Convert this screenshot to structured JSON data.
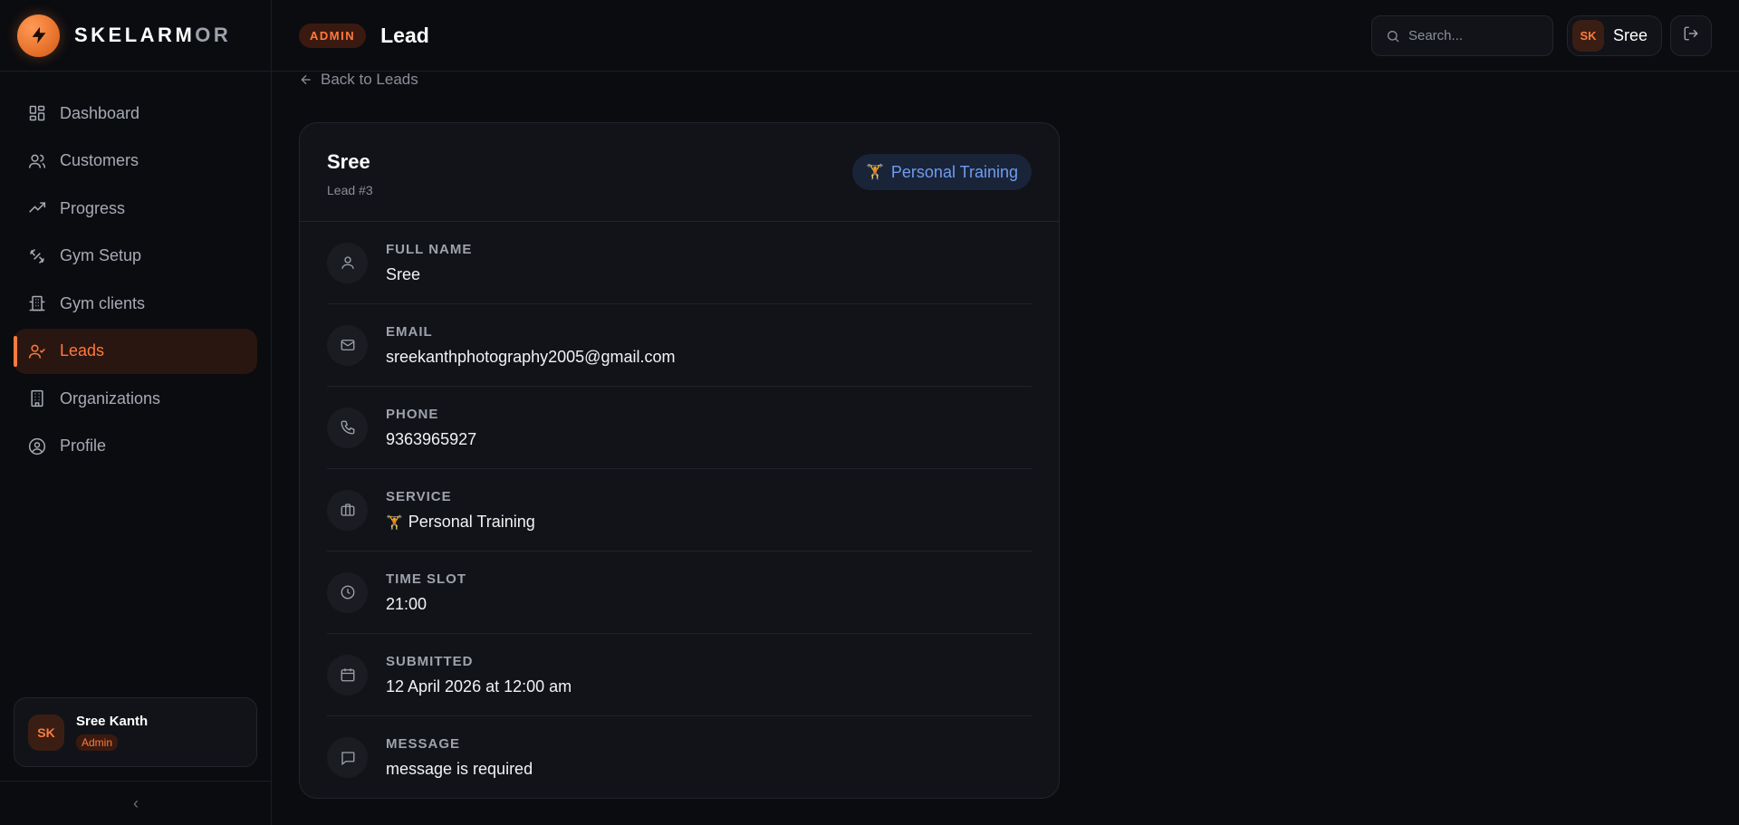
{
  "brand": {
    "name_main": "SKELARM",
    "name_dim": "OR"
  },
  "sidebar": {
    "items": [
      {
        "label": "Dashboard",
        "icon": "grid-icon"
      },
      {
        "label": "Customers",
        "icon": "users-icon"
      },
      {
        "label": "Progress",
        "icon": "trending-up-icon"
      },
      {
        "label": "Gym Setup",
        "icon": "dumbbell-icon"
      },
      {
        "label": "Gym clients",
        "icon": "building-icon"
      },
      {
        "label": "Leads",
        "icon": "user-check-icon",
        "active": true
      },
      {
        "label": "Organizations",
        "icon": "office-icon"
      },
      {
        "label": "Profile",
        "icon": "user-circle-icon"
      }
    ],
    "user": {
      "initials": "SK",
      "name": "Sree Kanth",
      "role": "Admin"
    },
    "collapse_glyph": "‹"
  },
  "header": {
    "badge": "ADMIN",
    "title": "Lead",
    "search_placeholder": "Search...",
    "user_initials": "SK",
    "user_name": "Sree"
  },
  "back_link": "Back to Leads",
  "lead": {
    "name": "Sree",
    "id_label": "Lead #3",
    "service_badge": "Personal Training",
    "service_emoji": "🏋",
    "fields": [
      {
        "label": "FULL NAME",
        "value": "Sree",
        "icon": "user-icon"
      },
      {
        "label": "EMAIL",
        "value": "sreekanthphotography2005@gmail.com",
        "icon": "mail-icon"
      },
      {
        "label": "PHONE",
        "value": "9363965927",
        "icon": "phone-icon"
      },
      {
        "label": "SERVICE",
        "value": "Personal Training",
        "icon": "briefcase-icon"
      },
      {
        "label": "TIME SLOT",
        "value": "21:00",
        "icon": "clock-icon"
      },
      {
        "label": "SUBMITTED",
        "value": "12 April 2026 at 12:00 am",
        "icon": "calendar-icon"
      },
      {
        "label": "MESSAGE",
        "value": "message is required",
        "icon": "message-icon"
      }
    ]
  },
  "colors": {
    "accent": "#ff7a3c",
    "service_blue": "#6f9cf2",
    "bg": "#0b0c10",
    "card": "#111318"
  }
}
